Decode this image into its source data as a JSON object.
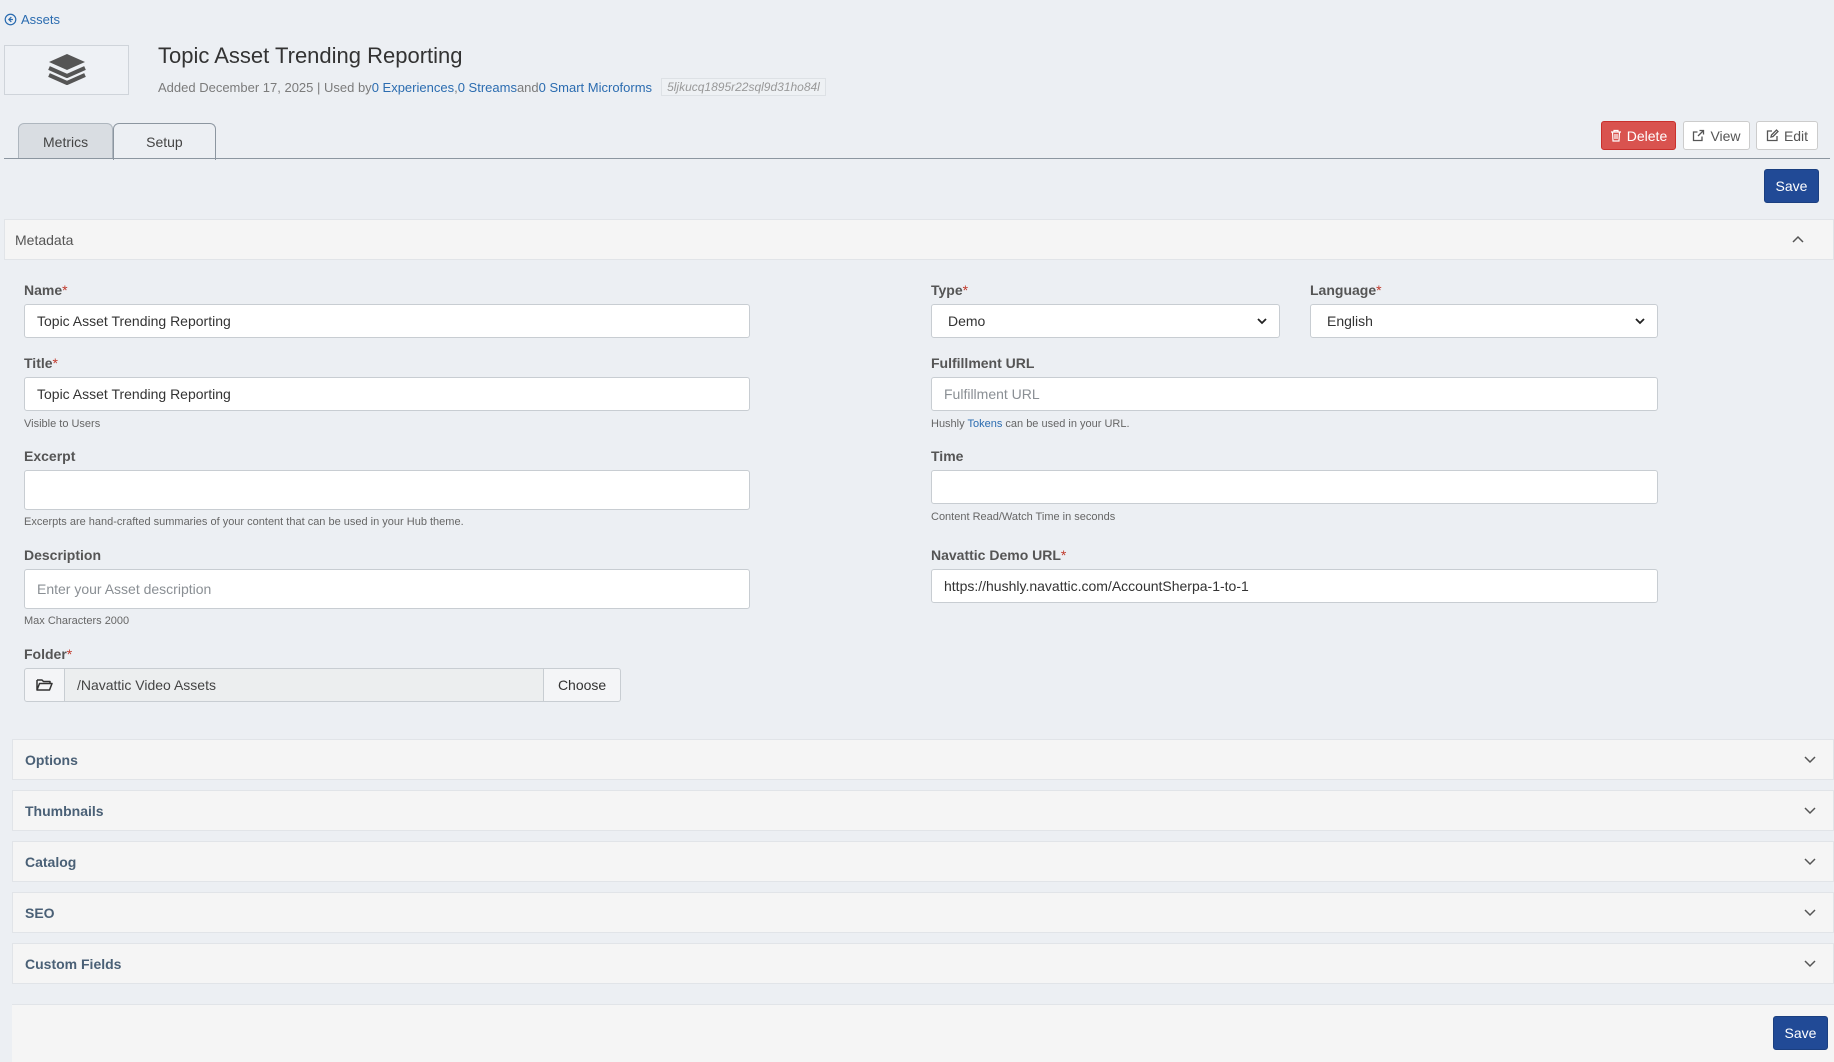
{
  "back_link": {
    "label": "Assets"
  },
  "header": {
    "title": "Topic Asset Trending Reporting",
    "added": "Added December 17, 2025 | Used by ",
    "experiences": "0 Experiences",
    "sep1": " , ",
    "streams": "0 Streams",
    "and": " and ",
    "microforms": "0 Smart Microforms",
    "asset_id": "5ljkucq1895r22sql9d31ho84l"
  },
  "tabs": [
    {
      "label": "Metrics",
      "active": false
    },
    {
      "label": "Setup",
      "active": true
    }
  ],
  "actions": {
    "delete": "Delete",
    "view": "View",
    "edit": "Edit",
    "save": "Save"
  },
  "metadata": {
    "heading": "Metadata",
    "name": {
      "label": "Name",
      "required": "*",
      "value": "Topic Asset Trending Reporting"
    },
    "title": {
      "label": "Title",
      "required": "*",
      "value": "Topic Asset Trending Reporting",
      "help": "Visible to Users"
    },
    "excerpt": {
      "label": "Excerpt",
      "value": "",
      "help": "Excerpts are hand-crafted summaries of your content that can be used in your Hub theme."
    },
    "description": {
      "label": "Description",
      "placeholder": "Enter your Asset description",
      "help": "Max Characters 2000"
    },
    "folder": {
      "label": "Folder",
      "required": "*",
      "path": "/Navattic Video Assets",
      "choose": "Choose"
    },
    "type": {
      "label": "Type",
      "required": "*",
      "selected": "Demo"
    },
    "language": {
      "label": "Language",
      "required": "*",
      "selected": "English"
    },
    "fulfillment": {
      "label": "Fulfillment URL",
      "placeholder": "Fulfillment URL",
      "help_pre": "Hushly ",
      "help_link": "Tokens",
      "help_post": " can be used in your URL."
    },
    "time": {
      "label": "Time",
      "value": "",
      "help": "Content Read/Watch Time in seconds"
    },
    "navattic": {
      "label": "Navattic Demo URL",
      "required": "*",
      "value": "https://hushly.navattic.com/AccountSherpa-1-to-1"
    }
  },
  "sections": [
    {
      "label": "Options"
    },
    {
      "label": "Thumbnails"
    },
    {
      "label": "Catalog"
    },
    {
      "label": "SEO"
    },
    {
      "label": "Custom Fields"
    }
  ],
  "colors": {
    "primary": "#214a96",
    "danger": "#d9534f",
    "link": "#2b6cb0"
  },
  "icons": [
    "arrow-circle-left-icon",
    "layers-icon",
    "trash-icon",
    "external-link-icon",
    "edit-icon",
    "chevron-up-icon",
    "chevron-down-icon",
    "folder-open-icon"
  ]
}
